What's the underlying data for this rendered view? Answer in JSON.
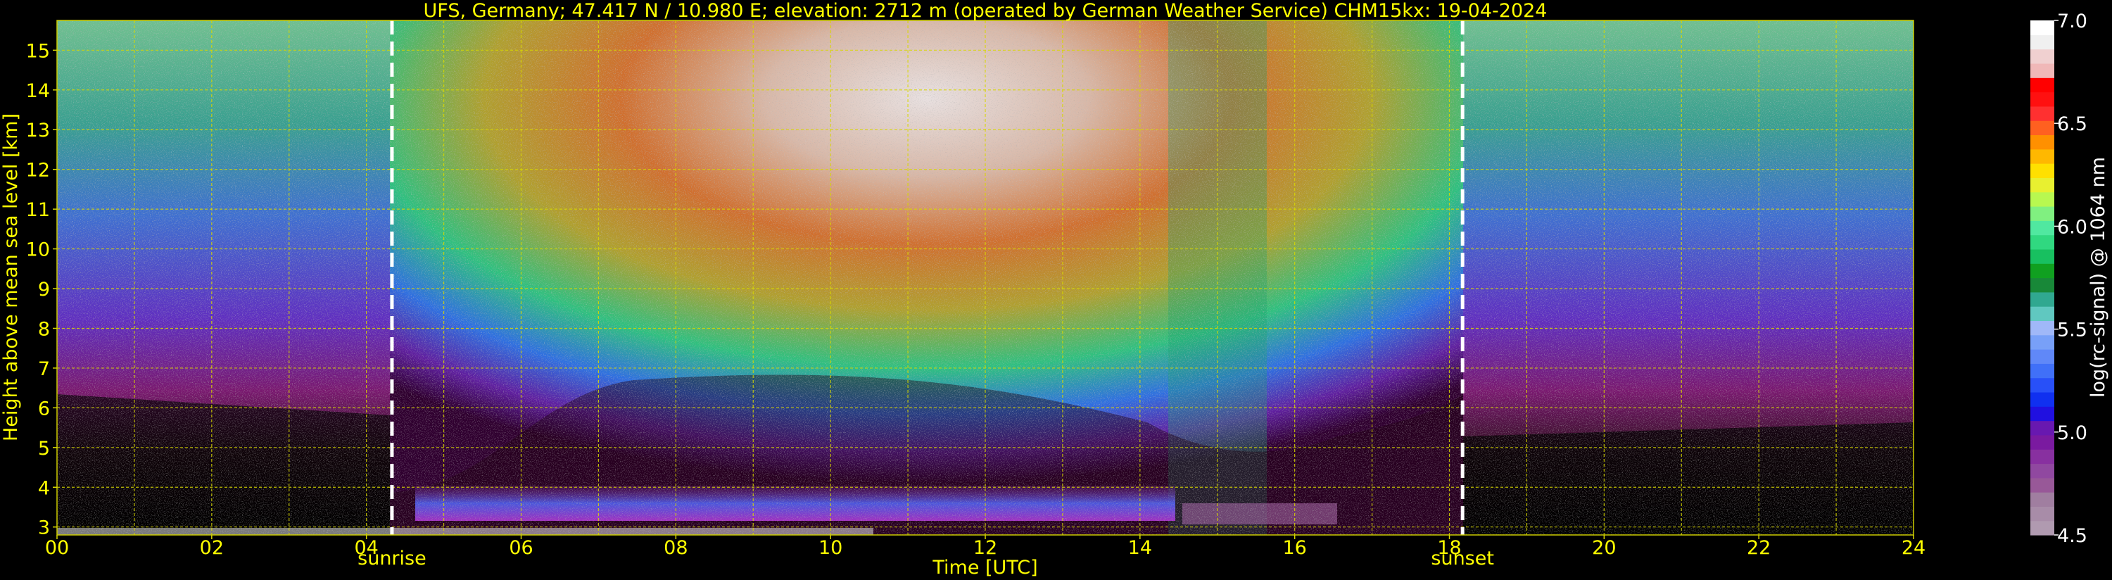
{
  "chart_data": {
    "type": "heatmap",
    "title": "UFS, Germany; 47.417 N / 10.980 E; elevation: 2712 m  (operated by German Weather Service)    CHM15kx: 19-04-2024",
    "xlabel": "Time [UTC]",
    "ylabel": "Height above mean sea level [km]",
    "xlim": [
      0,
      24
    ],
    "ylim": [
      2.8,
      15.75
    ],
    "x_ticks": [
      "00",
      "02",
      "04",
      "06",
      "08",
      "10",
      "12",
      "14",
      "16",
      "18",
      "20",
      "22",
      "24"
    ],
    "y_ticks": [
      "3",
      "4",
      "5",
      "6",
      "7",
      "8",
      "9",
      "10",
      "11",
      "12",
      "13",
      "14",
      "15"
    ],
    "grid": true,
    "annotations": [
      {
        "label": "sunrise",
        "x": 4.33
      },
      {
        "label": "sunset",
        "x": 18.17
      }
    ],
    "colorbar": {
      "label": "log(rc-signal) @ 1064 nm",
      "range": [
        4.5,
        7.0
      ],
      "ticks": [
        "4.5",
        "5.0",
        "5.5",
        "6.0",
        "6.5",
        "7.0"
      ]
    },
    "colors": {
      "axis_text": "#ffff00",
      "grid": "#d8d800",
      "background": "#000000",
      "sun_lines": "#ffffff",
      "colorbar_scale": [
        "#b09ab0",
        "#a88ca8",
        "#a07ea0",
        "#985898",
        "#9048a0",
        "#8830a0",
        "#7a1aa0",
        "#6818b0",
        "#2010e0",
        "#1030f0",
        "#2850f8",
        "#4070f8",
        "#6088f8",
        "#78a0f8",
        "#a0b8f8",
        "#60c8c0",
        "#30a890",
        "#188838",
        "#10a020",
        "#18c060",
        "#30d880",
        "#50e8a0",
        "#80f080",
        "#b8f850",
        "#e8f030",
        "#ffe000",
        "#ffb800",
        "#ff9000",
        "#ff6020",
        "#ff3030",
        "#ff1010",
        "#ff0000",
        "#f0b8b8",
        "#f0d0d0",
        "#f0f0f0",
        "#ffffff"
      ]
    }
  }
}
